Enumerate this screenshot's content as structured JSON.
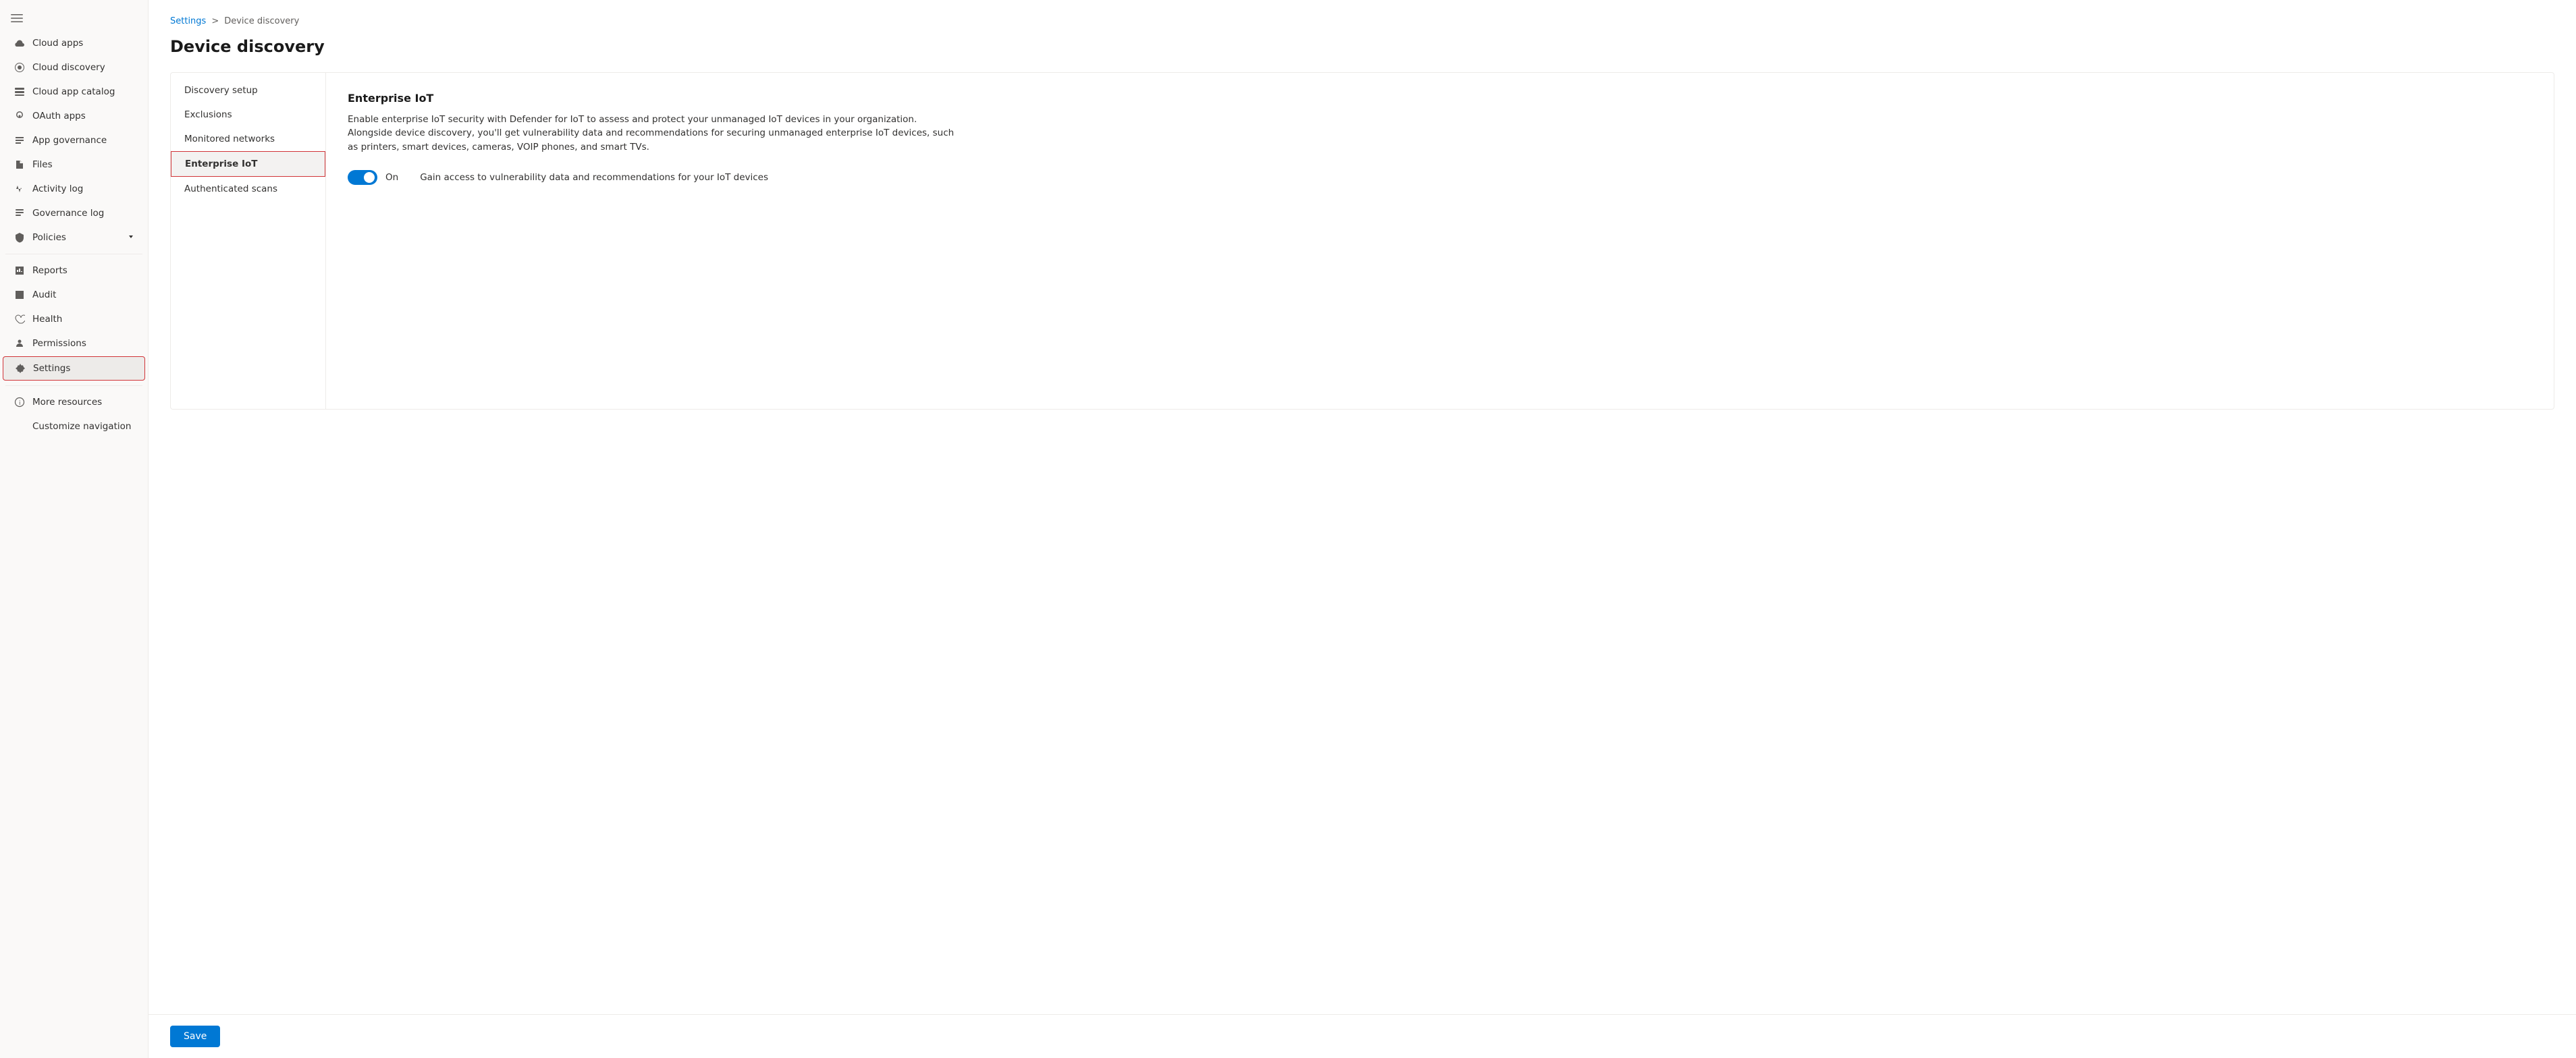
{
  "sidebar": {
    "header_icon": "menu",
    "items": [
      {
        "id": "cloud-apps",
        "label": "Cloud apps",
        "icon": "cloud-apps"
      },
      {
        "id": "cloud-discovery",
        "label": "Cloud discovery",
        "icon": "cloud-discovery"
      },
      {
        "id": "cloud-app-catalog",
        "label": "Cloud app catalog",
        "icon": "catalog"
      },
      {
        "id": "oauth-apps",
        "label": "OAuth apps",
        "icon": "oauth"
      },
      {
        "id": "app-governance",
        "label": "App governance",
        "icon": "app-governance"
      },
      {
        "id": "files",
        "label": "Files",
        "icon": "files"
      },
      {
        "id": "activity-log",
        "label": "Activity log",
        "icon": "activity"
      },
      {
        "id": "governance-log",
        "label": "Governance log",
        "icon": "governance"
      },
      {
        "id": "policies",
        "label": "Policies",
        "icon": "policies",
        "has_chevron": true
      },
      {
        "id": "reports",
        "label": "Reports",
        "icon": "reports"
      },
      {
        "id": "audit",
        "label": "Audit",
        "icon": "audit"
      },
      {
        "id": "health",
        "label": "Health",
        "icon": "health"
      },
      {
        "id": "permissions",
        "label": "Permissions",
        "icon": "permissions"
      },
      {
        "id": "settings",
        "label": "Settings",
        "icon": "settings",
        "active": true
      },
      {
        "id": "more-resources",
        "label": "More resources",
        "icon": "more-resources"
      },
      {
        "id": "customize-navigation",
        "label": "Customize navigation",
        "icon": "customize"
      }
    ]
  },
  "breadcrumb": {
    "parent": "Settings",
    "separator": ">",
    "current": "Device discovery"
  },
  "page": {
    "title": "Device discovery"
  },
  "settings_nav": {
    "items": [
      {
        "id": "discovery-setup",
        "label": "Discovery setup"
      },
      {
        "id": "exclusions",
        "label": "Exclusions"
      },
      {
        "id": "monitored-networks",
        "label": "Monitored networks"
      },
      {
        "id": "enterprise-iot",
        "label": "Enterprise IoT",
        "active": true
      },
      {
        "id": "authenticated-scans",
        "label": "Authenticated scans"
      }
    ]
  },
  "enterprise_iot": {
    "title": "Enterprise IoT",
    "description": "Enable enterprise IoT security with Defender for IoT to assess and protect your unmanaged IoT devices in your organization. Alongside device discovery, you'll get vulnerability data and recommendations for securing unmanaged enterprise IoT devices, such as printers, smart devices, cameras, VOIP phones, and smart TVs.",
    "toggle_state": "On",
    "toggle_enabled": true,
    "toggle_desc": "Gain access to vulnerability data and recommendations for your IoT devices"
  },
  "footer": {
    "save_button": "Save"
  }
}
